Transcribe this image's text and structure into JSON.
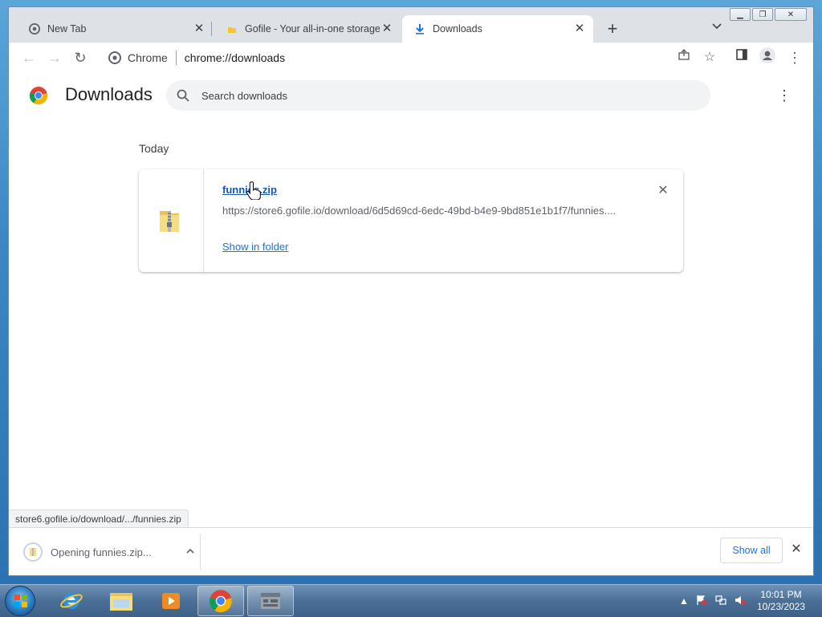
{
  "browser": {
    "tabs": [
      {
        "title": "New Tab",
        "active": false
      },
      {
        "title": "Gofile - Your all-in-one storage s",
        "active": false
      },
      {
        "title": "Downloads",
        "active": true
      }
    ],
    "omnibox": {
      "label": "Chrome",
      "url": "chrome://downloads"
    }
  },
  "page": {
    "title": "Downloads",
    "search_placeholder": "Search downloads",
    "section_label": "Today",
    "download": {
      "filename": "funnies.zip",
      "url": "https://store6.gofile.io/download/6d5d69cd-6edc-49bd-b4e9-9bd851e1b1f7/funnies....",
      "action": "Show in folder"
    }
  },
  "status_bar": {
    "text": "store6.gofile.io/download/.../funnies.zip"
  },
  "download_shelf": {
    "item_text": "Opening funnies.zip...",
    "show_all_label": "Show all"
  },
  "taskbar": {
    "time": "10:01 PM",
    "date": "10/23/2023"
  }
}
